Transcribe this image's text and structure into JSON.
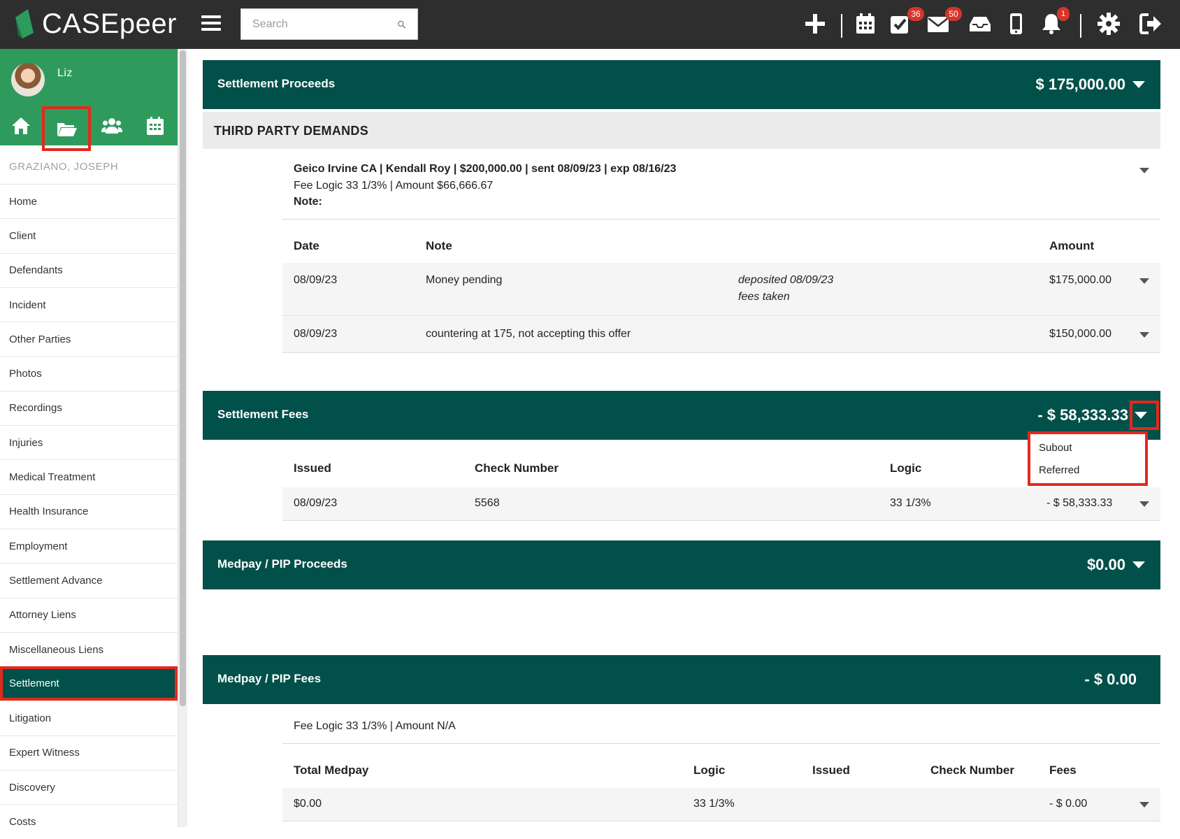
{
  "app": {
    "logo_text": "CASEpeer"
  },
  "search": {
    "placeholder": "Search"
  },
  "topbar": {
    "icons": [
      "plus-icon",
      "calendar-icon",
      "tasks-icon",
      "mail-icon",
      "inbox-icon",
      "mobile-icon",
      "bell-icon",
      "gear-icon",
      "logout-icon"
    ],
    "tasks_badge": "36",
    "mail_badge": "50",
    "bell_badge": "1"
  },
  "sidebar": {
    "user_name": "Liz",
    "case_name": "GRAZIANO, JOSEPH",
    "items": [
      {
        "label": "Home"
      },
      {
        "label": "Client"
      },
      {
        "label": "Defendants"
      },
      {
        "label": "Incident"
      },
      {
        "label": "Other Parties"
      },
      {
        "label": "Photos"
      },
      {
        "label": "Recordings"
      },
      {
        "label": "Injuries"
      },
      {
        "label": "Medical Treatment"
      },
      {
        "label": "Health Insurance"
      },
      {
        "label": "Employment"
      },
      {
        "label": "Settlement Advance"
      },
      {
        "label": "Attorney Liens"
      },
      {
        "label": "Miscellaneous Liens"
      },
      {
        "label": "Settlement"
      },
      {
        "label": "Litigation"
      },
      {
        "label": "Expert Witness"
      },
      {
        "label": "Discovery"
      },
      {
        "label": "Costs"
      }
    ],
    "active_item": "Settlement"
  },
  "settlement_proceeds": {
    "title": "Settlement Proceeds",
    "amount": "$ 175,000.00",
    "subheading": "THIRD PARTY DEMANDS",
    "demand": {
      "line1": "Geico Irvine CA | Kendall Roy | $200,000.00 | sent 08/09/23 | exp 08/16/23",
      "line2": "Fee Logic 33 1/3% | Amount $66,666.67",
      "note_label": "Note:"
    },
    "columns": [
      "Date",
      "Note",
      "Amount"
    ],
    "rows": [
      {
        "date": "08/09/23",
        "note": "Money pending",
        "extra1": "deposited 08/09/23",
        "extra2": "fees taken",
        "amount": "$175,000.00"
      },
      {
        "date": "08/09/23",
        "note": "countering at 175, not accepting this offer",
        "extra1": "",
        "extra2": "",
        "amount": "$150,000.00"
      }
    ]
  },
  "settlement_fees": {
    "title": "Settlement Fees",
    "amount": "- $ 58,333.33",
    "columns": [
      "Issued",
      "Check Number",
      "Logic"
    ],
    "rows": [
      {
        "issued": "08/09/23",
        "check_number": "5568",
        "logic": "33 1/3%",
        "amount": "- $ 58,333.33"
      }
    ],
    "dropdown_options": [
      "Subout",
      "Referred"
    ]
  },
  "medpay_proceeds": {
    "title": "Medpay / PIP Proceeds",
    "amount": "$0.00"
  },
  "medpay_fees": {
    "title": "Medpay / PIP Fees",
    "amount": "- $ 0.00",
    "fee_logic": "Fee Logic 33 1/3% | Amount N/A",
    "columns": [
      "Total Medpay",
      "Logic",
      "Issued",
      "Check Number",
      "Fees"
    ],
    "rows": [
      {
        "total": "$0.00",
        "logic": "33 1/3%",
        "issued": "",
        "check_number": "",
        "fees": "- $ 0.00"
      }
    ]
  },
  "colors": {
    "brand_green": "#2e9b5d",
    "header_teal": "#02504a",
    "highlight_red": "#e3291c",
    "badge_red": "#d6352b"
  }
}
